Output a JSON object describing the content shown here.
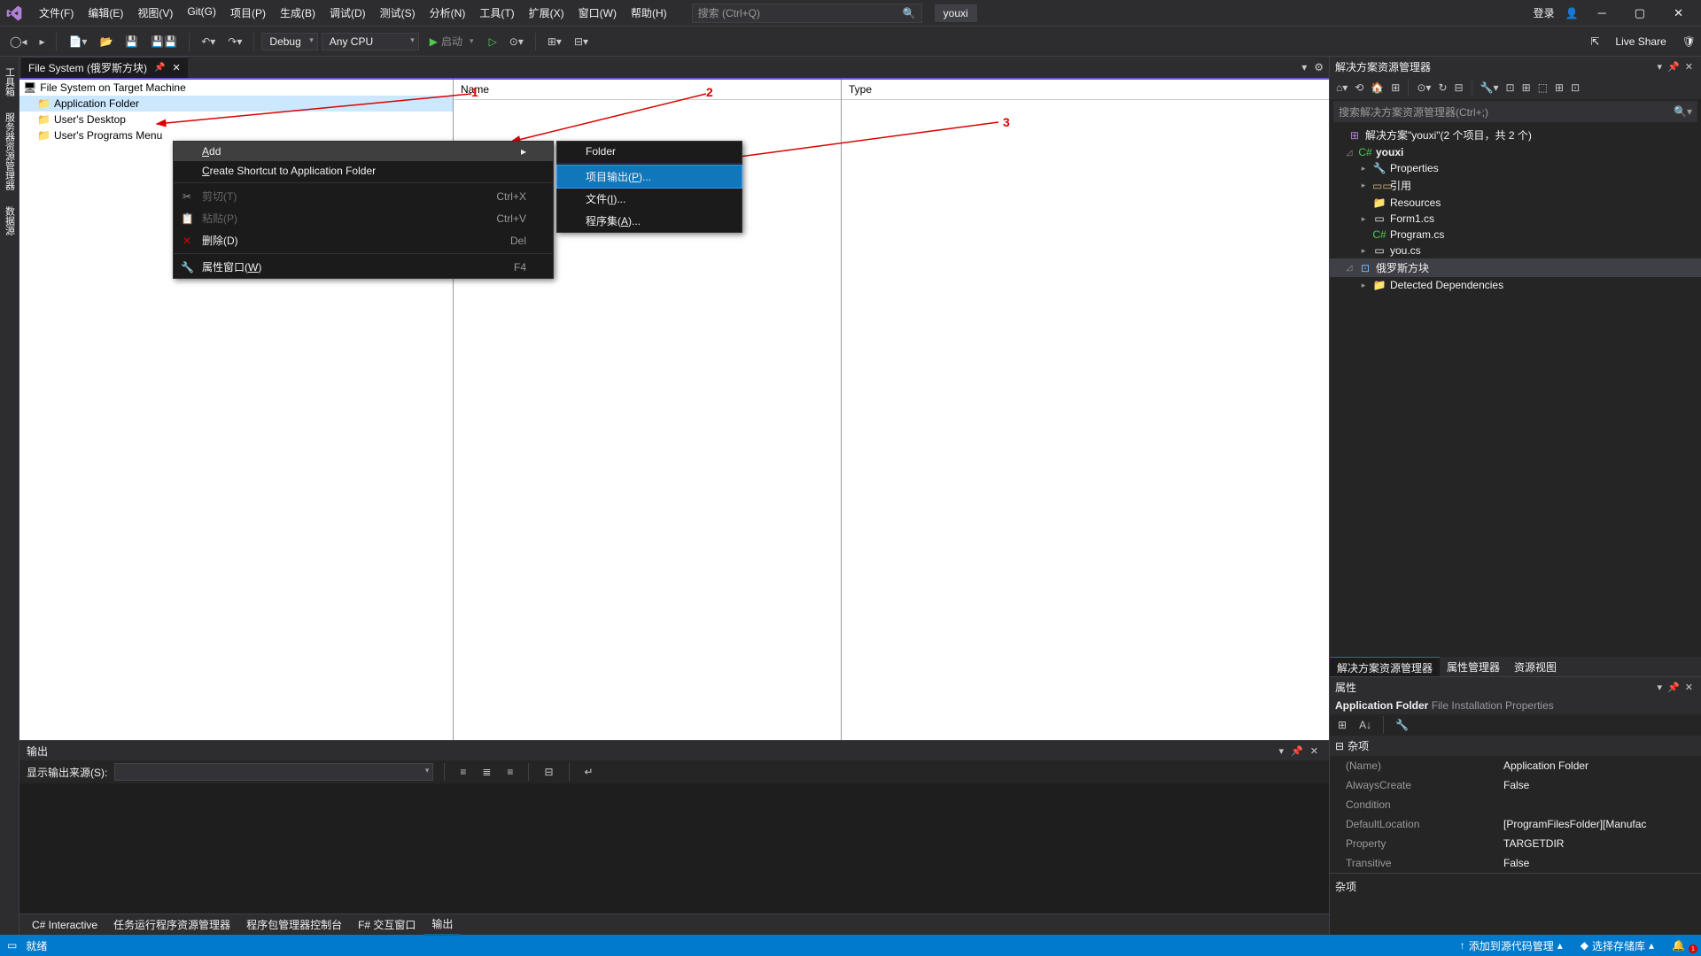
{
  "menus": [
    "文件(F)",
    "编辑(E)",
    "视图(V)",
    "Git(G)",
    "项目(P)",
    "生成(B)",
    "调试(D)",
    "测试(S)",
    "分析(N)",
    "工具(T)",
    "扩展(X)",
    "窗口(W)",
    "帮助(H)"
  ],
  "search_placeholder": "搜索 (Ctrl+Q)",
  "user": "youxi",
  "login": "登录",
  "config": "Debug",
  "platform": "Any CPU",
  "start_label": "启动",
  "liveshare": "Live Share",
  "doc_tab": "File System (俄罗斯方块)",
  "tree": {
    "root": "File System on Target Machine",
    "items": [
      "Application Folder",
      "User's Desktop",
      "User's Programs Menu"
    ]
  },
  "col_name": "Name",
  "col_type": "Type",
  "annotations": {
    "a1": "1",
    "a2": "2",
    "a3": "3"
  },
  "ctx1": {
    "add": "Add",
    "shortcut": "Create Shortcut to Application Folder",
    "cut": "剪切(T)",
    "cut_k": "Ctrl+X",
    "paste": "粘贴(P)",
    "paste_k": "Ctrl+V",
    "delete": "删除(D)",
    "delete_k": "Del",
    "props": "属性窗口(W)",
    "props_k": "F4"
  },
  "ctx2": {
    "folder": "Folder",
    "output": "项目输出(P)...",
    "file": "文件(I)...",
    "assembly": "程序集(A)..."
  },
  "rail": [
    "工具箱",
    "服务器资源管理器",
    "数据源"
  ],
  "output": {
    "title": "输出",
    "src_label": "显示输出来源(S):",
    "tabs": [
      "C# Interactive",
      "任务运行程序资源管理器",
      "程序包管理器控制台",
      "F# 交互窗口",
      "输出"
    ]
  },
  "sol": {
    "title": "解决方案资源管理器",
    "search": "搜索解决方案资源管理器(Ctrl+;)",
    "root": "解决方案\"youxi\"(2 个项目，共 2 个)",
    "proj": "youxi",
    "items": [
      "Properties",
      "引用",
      "Resources",
      "Form1.cs",
      "Program.cs",
      "you.cs"
    ],
    "proj2": "俄罗斯方块",
    "proj2_items": [
      "Detected Dependencies"
    ],
    "tabs": [
      "解决方案资源管理器",
      "属性管理器",
      "资源视图"
    ]
  },
  "props": {
    "title": "属性",
    "obj": "Application Folder",
    "obj_type": "File Installation Properties",
    "cat": "杂项",
    "rows": [
      {
        "n": "(Name)",
        "v": "Application Folder"
      },
      {
        "n": "AlwaysCreate",
        "v": "False"
      },
      {
        "n": "Condition",
        "v": ""
      },
      {
        "n": "DefaultLocation",
        "v": "[ProgramFilesFolder][Manufac"
      },
      {
        "n": "Property",
        "v": "TARGETDIR"
      },
      {
        "n": "Transitive",
        "v": "False"
      }
    ],
    "desc": "杂项"
  },
  "status": {
    "ready": "就绪",
    "add_source": "添加到源代码管理",
    "select_repo": "选择存储库"
  }
}
